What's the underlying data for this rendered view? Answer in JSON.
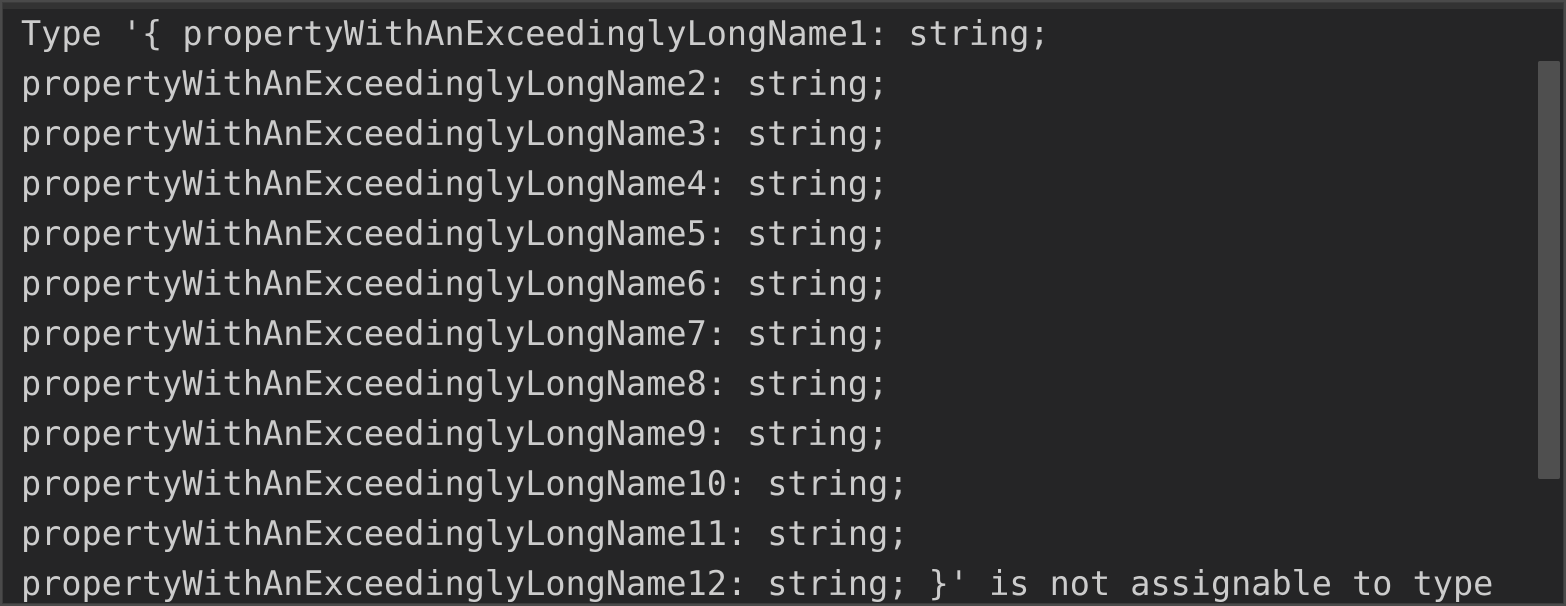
{
  "hover_panel": {
    "message_lines": [
      "Type '{ propertyWithAnExceedinglyLongName1: string;",
      "propertyWithAnExceedinglyLongName2: string;",
      "propertyWithAnExceedinglyLongName3: string;",
      "propertyWithAnExceedinglyLongName4: string;",
      "propertyWithAnExceedinglyLongName5: string;",
      "propertyWithAnExceedinglyLongName6: string;",
      "propertyWithAnExceedinglyLongName7: string;",
      "propertyWithAnExceedinglyLongName8: string;",
      "propertyWithAnExceedinglyLongName9: string;",
      "propertyWithAnExceedinglyLongName10: string;",
      "propertyWithAnExceedinglyLongName11: string;",
      "propertyWithAnExceedinglyLongName12: string; }' is not assignable to type"
    ]
  },
  "colors": {
    "background": "#252526",
    "text": "#cccccc",
    "scrollbar_thumb": "#4f4f4f"
  }
}
